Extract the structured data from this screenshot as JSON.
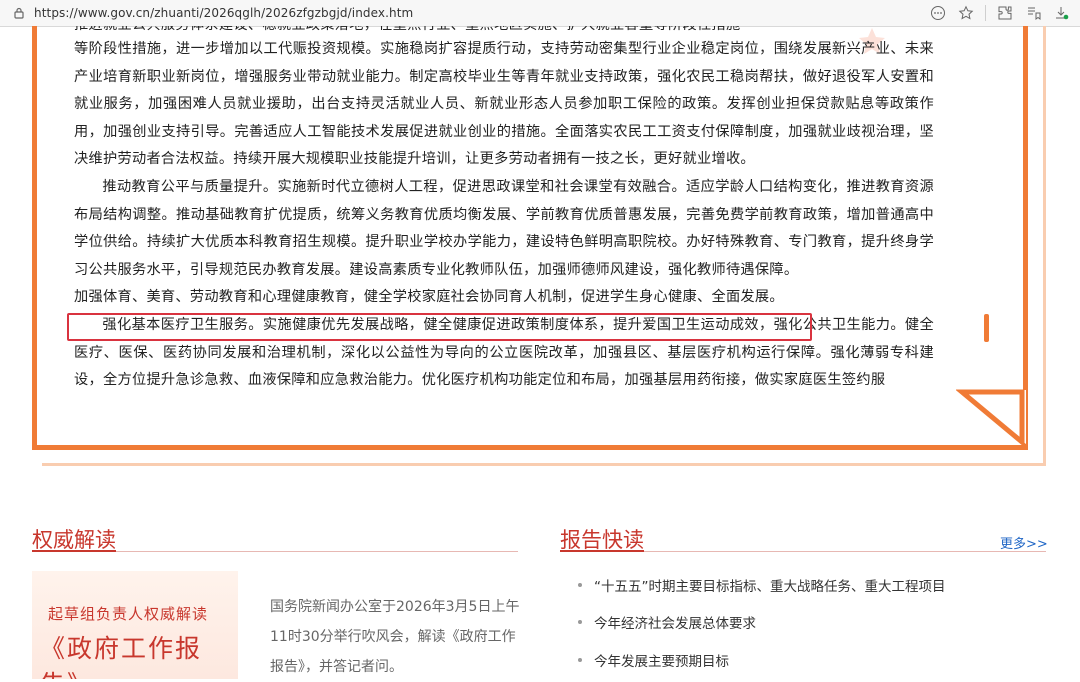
{
  "browser": {
    "url": "https://www.gov.cn/zhuanti/2026qglh/2026zfgzbgjd/index.htm",
    "icons": [
      "lock-icon",
      "more-icon",
      "favorite-star-icon",
      "extensions-icon",
      "collections-icon",
      "download-icon"
    ]
  },
  "report": {
    "paragraphs": [
      "等阶段性措施，进一步增加以工代赈投资规模。实施稳岗扩容提质行动，支持劳动密集型行业企业稳定岗位，围绕发展新兴产业、未来产业培育新职业新岗位，增强服务业带动就业能力。制定高校毕业生等青年就业支持政策，强化农民工稳岗帮扶，做好退役军人安置和就业服务，加强困难人员就业援助，出台支持灵活就业人员、新就业形态人员参加职工保险的政策。发挥创业担保贷款贴息等政策作用，加强创业支持引导。完善适应人工智能技术发展促进就业创业的措施。全面落实农民工工资支付保障制度，加强就业歧视治理，坚决维护劳动者合法权益。持续开展大规模职业技能提升培训，让更多劳动者拥有一技之长，更好就业增收。",
      "推动教育公平与质量提升。实施新时代立德树人工程，促进思政课堂和社会课堂有效融合。适应学龄人口结构变化，推进教育资源布局结构调整。推动基础教育扩优提质，统筹义务教育优质均衡发展、学前教育优质普惠发展，完善免费学前教育政策，增加普通高中学位供给。持续扩大优质本科教育招生规模。提升职业学校办学能力，建设特色鲜明高职院校。办好特殊教育、专门教育，提升终身学习公共服务水平，引导规范民办教育发展。建设高素质专业化教师队伍，加强师德师风建设，强化教师待遇保障。",
      "加强体育、美育、劳动教育和心理健康教育，健全学校家庭社会协同育人机制，促进学生身心健康、全面发展。",
      "强化基本医疗卫生服务。实施健康优先发展战略，健全健康促进政策制度体系，提升爱国卫生运动成效，强化公共卫生能力。健全医疗、医保、医药协同发展和治理机制，深化以公益性为导向的公立医院改革，加强县区、基层医疗机构运行保障。强化薄弱专科建设，全方位提升急诊急救、血液保障和应急救治能力。优化医疗机构功能定位和布局，加强基层用药衔接，做实家庭医生签约服"
    ]
  },
  "authority": {
    "title": "权威解读",
    "image_subtitle": "起草组负责人权威解读",
    "image_title": "《政府工作报告》",
    "description": "国务院新闻办公室于2026年3月5日上午11时30分举行吹风会，解读《政府工作报告》，并答记者问。"
  },
  "quick_report": {
    "title": "报告快读",
    "more_label": "更多>>",
    "items": [
      "“十五五”时期主要目标指标、重大战略任务、重大工程项目",
      "今年经济社会发展总体要求",
      "今年发展主要预期目标"
    ]
  },
  "colors": {
    "accent_orange": "#f07b36",
    "title_red": "#c8372d",
    "highlight_red": "#d9333f",
    "link_blue": "#1f66c6"
  }
}
